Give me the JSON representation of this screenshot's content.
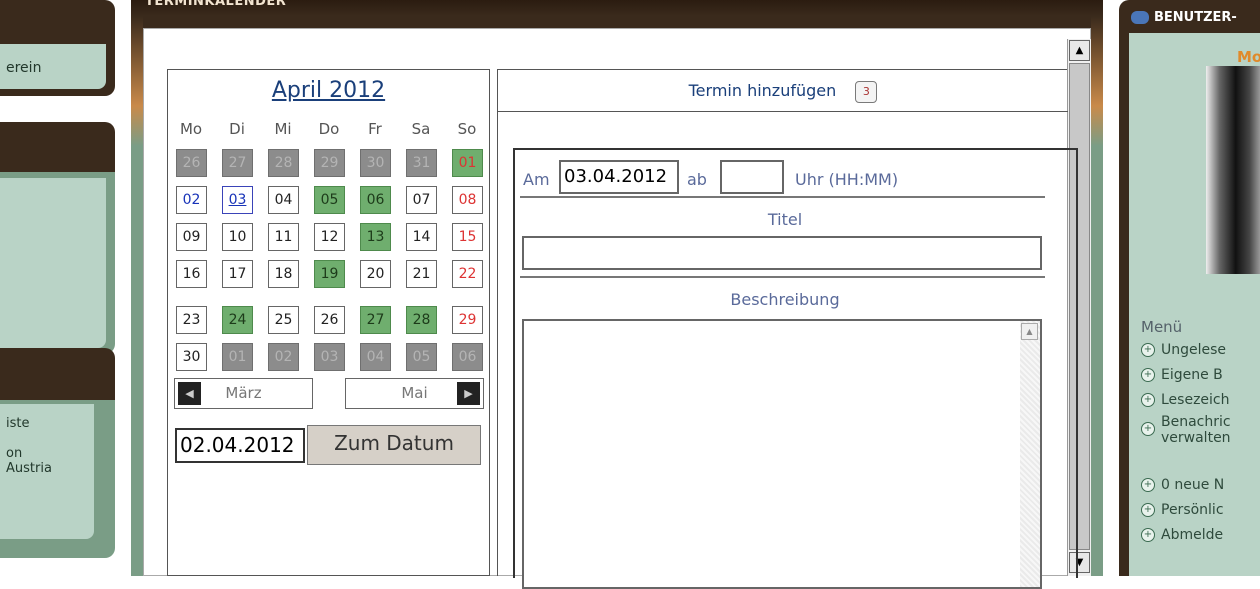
{
  "left_sidebar": {
    "panel1_text": "erein",
    "panel3_lines": [
      "iste",
      "on",
      "Austria"
    ]
  },
  "main": {
    "title": "TERMINKALENDER"
  },
  "calendar": {
    "month_label": "April 2012",
    "weekdays": [
      "Mo",
      "Di",
      "Mi",
      "Do",
      "Fr",
      "Sa",
      "So"
    ],
    "weeks": [
      [
        "26",
        "27",
        "28",
        "29",
        "30",
        "31",
        "01"
      ],
      [
        "02",
        "03",
        "04",
        "05",
        "06",
        "07",
        "08"
      ],
      [
        "09",
        "10",
        "11",
        "12",
        "13",
        "14",
        "15"
      ],
      [
        "16",
        "17",
        "18",
        "19",
        "20",
        "21",
        "22"
      ],
      [
        "23",
        "24",
        "25",
        "26",
        "27",
        "28",
        "29"
      ],
      [
        "30",
        "01",
        "02",
        "03",
        "04",
        "05",
        "06"
      ]
    ],
    "prev_month": "März",
    "next_month": "Mai",
    "prev_icon": "arrow-left-icon",
    "next_icon": "arrow-right-icon",
    "date_value": "02.04.2012",
    "goto_button": "Zum Datum"
  },
  "add_event": {
    "header": "Termin hinzufügen",
    "calendar_icon": "calendar-icon",
    "am_label": "Am",
    "date_value": "03.04.2012",
    "ab_label": "ab",
    "time_value": "",
    "uhr_label": "Uhr (HH:MM)",
    "titel_label": "Titel",
    "titel_value": "",
    "beschreibung_label": "Beschreibung",
    "beschreibung_value": ""
  },
  "right_sidebar": {
    "header": "BENUTZER-",
    "name": "Mo",
    "menu_label": "Menü",
    "items": [
      "Ungelese",
      "Eigene B",
      "Lesezeich",
      "Benachric",
      "verwalten",
      "0 neue N",
      "Persönlic",
      "Abmelde"
    ]
  },
  "colors": {
    "dark_brown": "#3a2a1c",
    "sage_green": "#b9d3c6",
    "event_green": "#6fae6e",
    "grey_day": "#8c8c8c",
    "link_blue": "#1a3f7a",
    "sunday_red": "#dd3333"
  }
}
